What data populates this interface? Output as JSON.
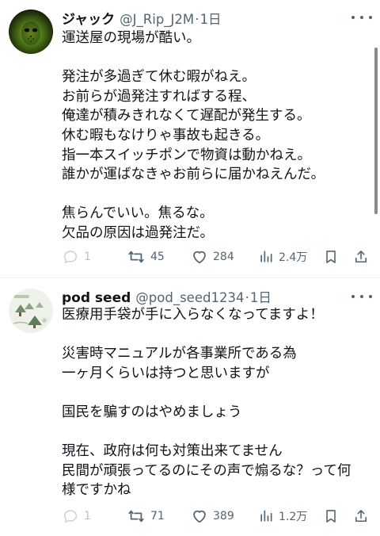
{
  "posts": [
    {
      "name": "ジャック",
      "handle": "@J_Rip_J2M",
      "separator": "·",
      "time": "1日",
      "lines": [
        "運送屋の現場が酷い。",
        "",
        "発注が多過ぎて休む暇がねえ。",
        "お前らが過発注すればする程、",
        "俺達が積みきれなくて遅配が発生する。",
        "休む暇もなけりゃ事故も起きる。",
        "指一本スイッチポンで物資は動かねえ。",
        "誰かが運ばなきゃお前らに届かねえんだ。",
        "",
        "焦らんでいい。焦るな。",
        "欠品の原因は過発注だ。"
      ],
      "replies": "1",
      "reposts": "45",
      "likes": "284",
      "views": "2.4万"
    },
    {
      "name": "pod seed",
      "handle": "@pod_seed1234",
      "separator": "·",
      "time": "1日",
      "lines": [
        "医療用手袋が手に入らなくなってますよ！",
        "",
        "災害時マニュアルが各事業所である為",
        "一ヶ月くらいは持つと思いますが",
        "",
        "国民を騙すのはやめましょう",
        "",
        "現在、政府は何も対策出来てません",
        "民間が頑張ってるのにその声で煽るな？って何",
        "様ですかね"
      ],
      "replies": "1",
      "reposts": "71",
      "likes": "389",
      "views": "1.2万"
    }
  ],
  "icons": {
    "reply": "speech-bubble",
    "repost": "arrows-loop",
    "like": "heart",
    "views": "bar-chart",
    "bookmark": "bookmark",
    "share": "upload-arrow",
    "more": "three-dots"
  },
  "colors": {
    "text": "#0f1419",
    "secondary": "#536471",
    "divider": "#eff3f4"
  }
}
